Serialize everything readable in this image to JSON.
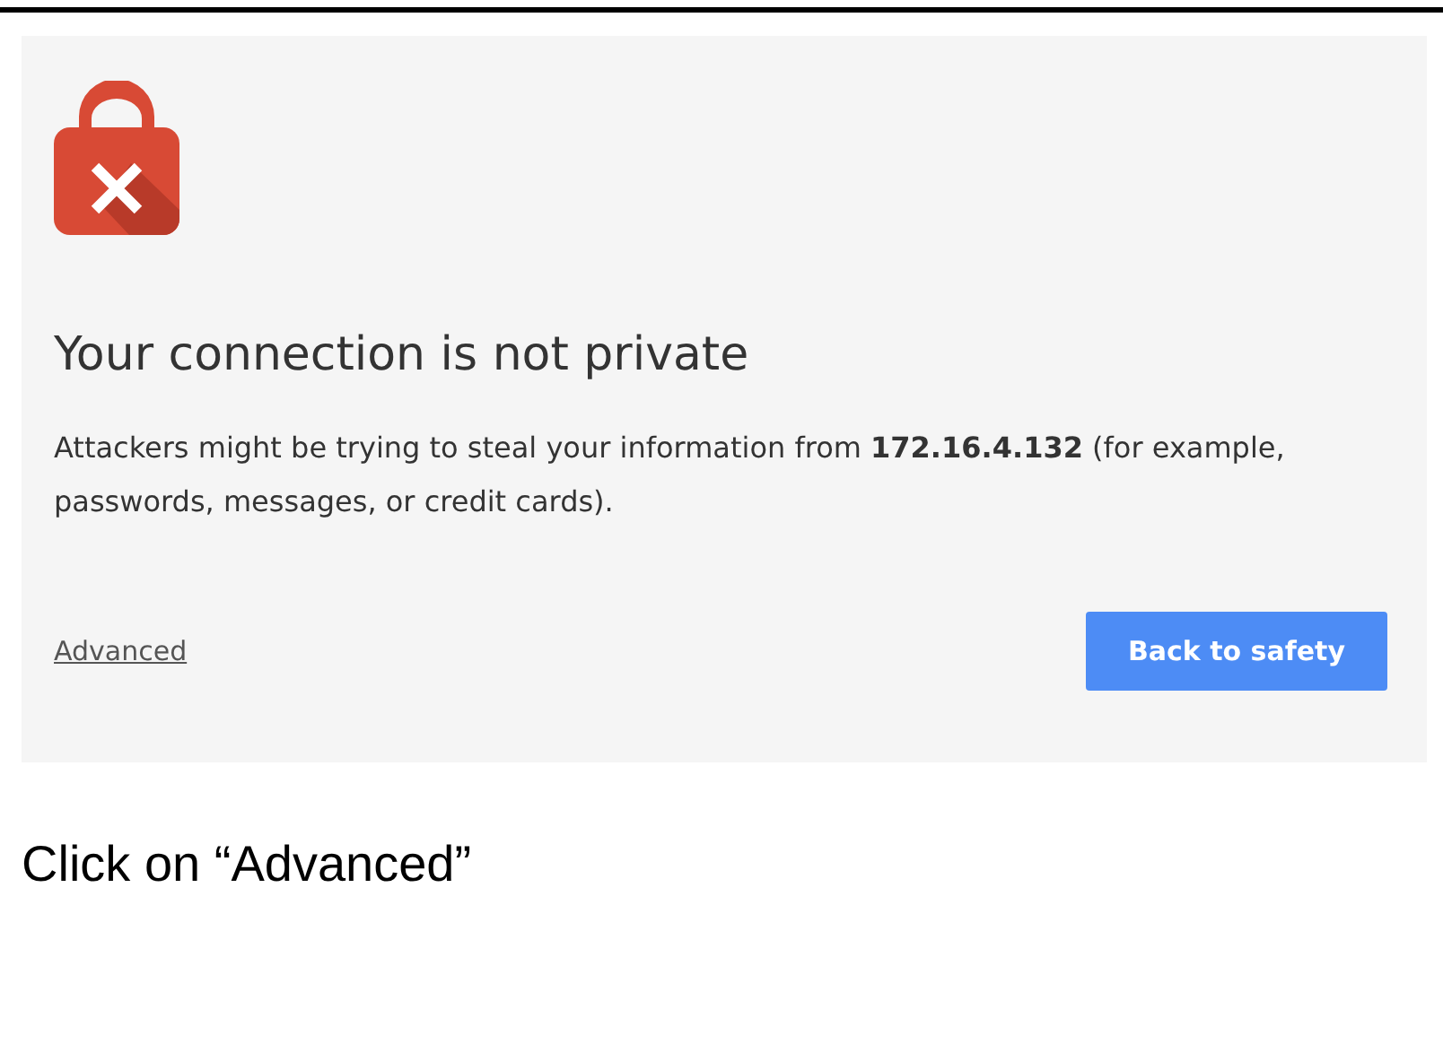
{
  "panel": {
    "heading": "Your connection is not private",
    "message": "Attackers might be trying to steal your information from **172.16.4.132** (for example, passwords, messages, or credit cards).",
    "advanced_link": "Advanced",
    "back_button": "Back to safety"
  },
  "caption": "Click on “Advanced”"
}
